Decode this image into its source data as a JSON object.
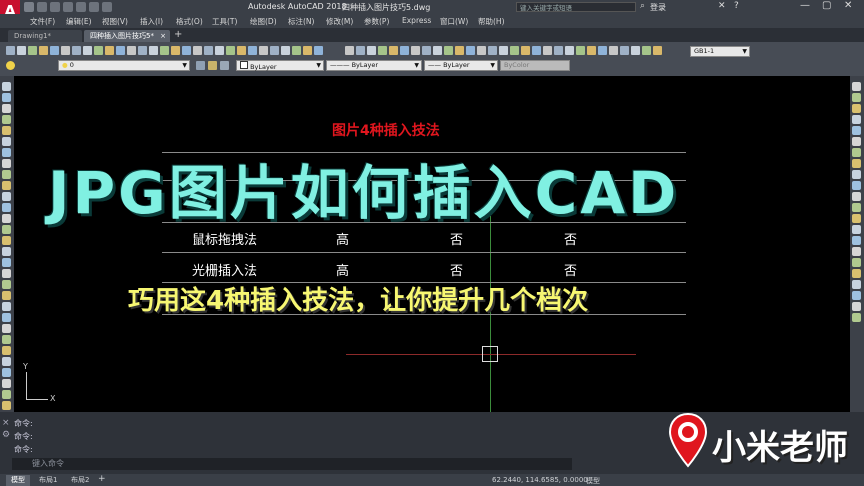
{
  "window": {
    "app_title": "Autodesk AutoCAD 2018",
    "file_title": "四种插入图片技巧5.dwg",
    "search_placeholder": "键入关键字或短语",
    "login": "登录"
  },
  "menu": [
    "文件(F)",
    "编辑(E)",
    "视图(V)",
    "插入(I)",
    "格式(O)",
    "工具(T)",
    "绘图(D)",
    "标注(N)",
    "修改(M)",
    "参数(P)",
    "Express",
    "窗口(W)",
    "帮助(H)"
  ],
  "tabs": [
    {
      "label": "Drawing1*"
    },
    {
      "label": "四种插入图片技巧5*"
    }
  ],
  "ribbon": {
    "layer_value": "0",
    "color_value": "ByLayer",
    "linetype_value": "ByLayer",
    "lineweight_value": "ByLayer",
    "plotstyle_value": "ByColor",
    "textstyle_value": "GB1-1"
  },
  "drawing": {
    "title": "图片4种插入技法",
    "rows": [
      {
        "method": "鼠标拖拽法",
        "c1": "高",
        "c2": "否",
        "c3": "否"
      },
      {
        "method": "光栅插入法",
        "c1": "高",
        "c2": "否",
        "c3": "否"
      }
    ],
    "ucs_x": "X",
    "ucs_y": "Y"
  },
  "overlay": {
    "headline": "JPG图片如何插入CAD",
    "subline": "巧用这4种插入技法，让你提升几个档次"
  },
  "command": {
    "lines": [
      "命令:",
      "命令:",
      "命令:"
    ],
    "input_placeholder": "键入命令"
  },
  "status": {
    "layout_tabs": [
      "模型",
      "布局1",
      "布局2"
    ],
    "coords": "62.2440, 114.6585, 0.0000",
    "space": "模型"
  },
  "brand": {
    "name": "小米老师",
    "color": "#e0161e"
  }
}
